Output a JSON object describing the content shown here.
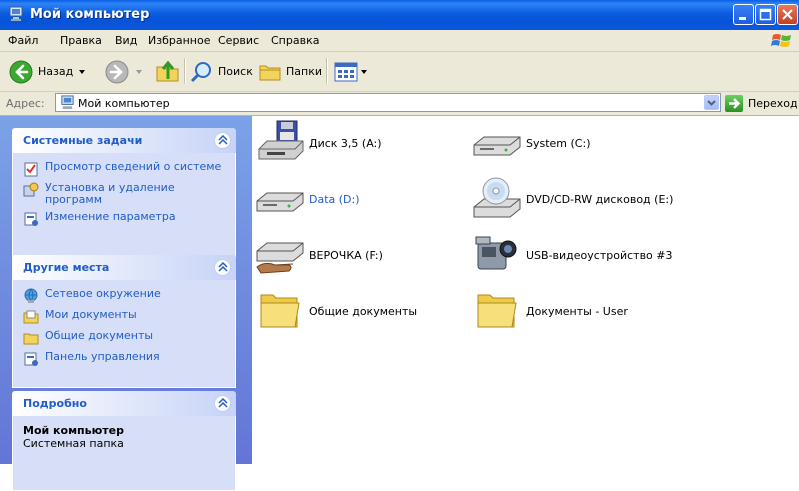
{
  "window": {
    "title": "Мой компьютер"
  },
  "menu": [
    "Файл",
    "Правка",
    "Вид",
    "Избранное",
    "Сервис",
    "Справка"
  ],
  "toolbar": {
    "back_label": "Назад",
    "search_label": "Поиск",
    "folders_label": "Папки"
  },
  "address": {
    "label": "Адрес:",
    "value": "Мой компьютер",
    "go_label": "Переход"
  },
  "left": {
    "system_tasks": {
      "title": "Системные задачи",
      "items": [
        "Просмотр сведений о системе",
        "Установка и удаление программ",
        "Изменение параметра"
      ]
    },
    "other_places": {
      "title": "Другие места",
      "items": [
        "Сетевое окружение",
        "Мои документы",
        "Общие документы",
        "Панель управления"
      ]
    },
    "details": {
      "title": "Подробно",
      "name": "Мой компьютер",
      "type": "Системная папка"
    }
  },
  "items": [
    {
      "label": "Диск 3,5 (A:)",
      "icon": "floppy-drive-icon"
    },
    {
      "label": "System (C:)",
      "icon": "hard-drive-icon"
    },
    {
      "label": "Data (D:)",
      "icon": "hard-drive-icon"
    },
    {
      "label": "DVD/CD-RW дисковод (E:)",
      "icon": "dvd-drive-icon"
    },
    {
      "label": "ВЕРОЧКА (F:)",
      "icon": "removable-drive-icon"
    },
    {
      "label": "USB-видеоустройство #3",
      "icon": "video-camera-icon"
    },
    {
      "label": "Общие документы",
      "icon": "folder-icon"
    },
    {
      "label": "Документы - User",
      "icon": "folder-icon"
    }
  ]
}
